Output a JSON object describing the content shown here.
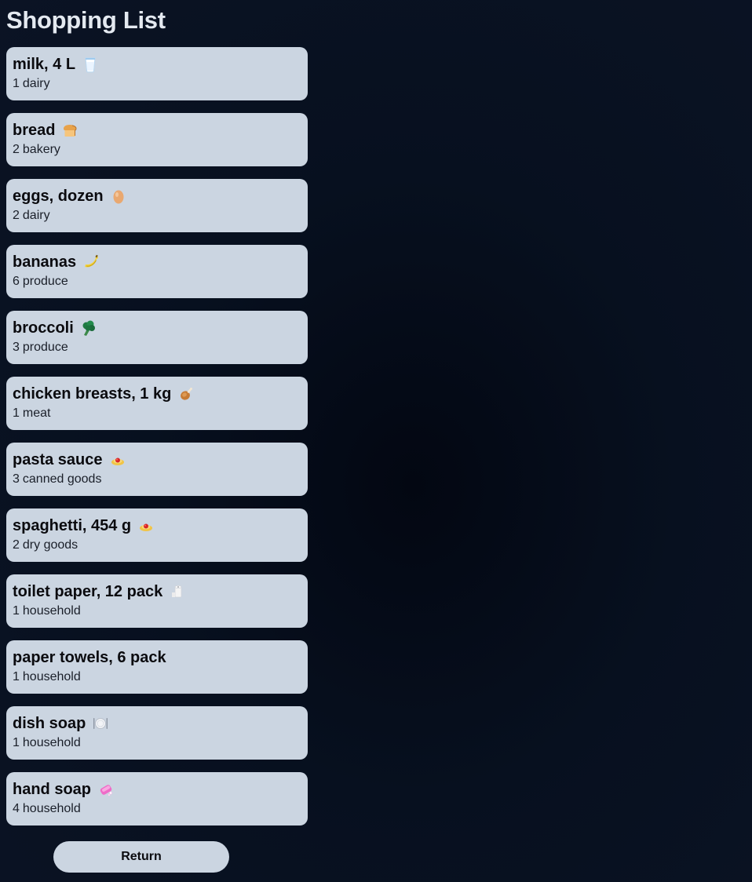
{
  "page": {
    "title": "Shopping List"
  },
  "items": [
    {
      "name": "milk, 4 L",
      "quantity": "1",
      "category": "dairy",
      "icon": "milk-glass-icon"
    },
    {
      "name": "bread",
      "quantity": "2",
      "category": "bakery",
      "icon": "bread-icon"
    },
    {
      "name": "eggs, dozen",
      "quantity": "2",
      "category": "dairy",
      "icon": "egg-icon"
    },
    {
      "name": "bananas",
      "quantity": "6",
      "category": "produce",
      "icon": "banana-icon"
    },
    {
      "name": "broccoli",
      "quantity": "3",
      "category": "produce",
      "icon": "broccoli-icon"
    },
    {
      "name": "chicken breasts, 1 kg",
      "quantity": "1",
      "category": "meat",
      "icon": "poultry-leg-icon"
    },
    {
      "name": "pasta sauce",
      "quantity": "3",
      "category": "canned goods",
      "icon": "spaghetti-icon"
    },
    {
      "name": "spaghetti, 454 g",
      "quantity": "2",
      "category": "dry goods",
      "icon": "spaghetti-icon"
    },
    {
      "name": "toilet paper, 12 pack",
      "quantity": "1",
      "category": "household",
      "icon": "toilet-roll-icon"
    },
    {
      "name": "paper towels, 6 pack",
      "quantity": "1",
      "category": "household",
      "icon": ""
    },
    {
      "name": "dish soap",
      "quantity": "1",
      "category": "household",
      "icon": "plate-icon"
    },
    {
      "name": "hand soap",
      "quantity": "4",
      "category": "household",
      "icon": "soap-bar-icon"
    }
  ],
  "actions": {
    "return_label": "Return"
  },
  "colors": {
    "background": "#0b1324",
    "card": "#cbd5e1",
    "title": "#e4e9f0",
    "card_text": "#0b0b0f"
  }
}
